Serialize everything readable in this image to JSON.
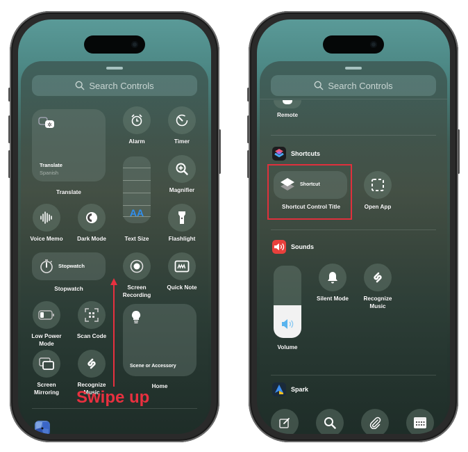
{
  "left_phone": {
    "search_placeholder": "Search Controls",
    "translate_tile": {
      "title": "Translate",
      "subtitle": "Spanish",
      "label": "Translate"
    },
    "controls": {
      "alarm": "Alarm",
      "timer": "Timer",
      "magnifier": "Magnifier",
      "text_size": "Text Size",
      "voice_memo": "Voice Memo",
      "dark_mode": "Dark Mode",
      "flashlight": "Flashlight",
      "stopwatch_tile": "Stopwatch",
      "stopwatch": "Stopwatch",
      "screen_recording": "Screen Recording",
      "quick_note": "Quick Note",
      "low_power_mode": "Low Power Mode",
      "scan_code": "Scan Code",
      "screen_mirroring": "Screen Mirroring",
      "recognize_music": "Recognize Music",
      "home_tile": "Scene or Accessory",
      "home": "Home"
    },
    "text_size_glyph": "AA",
    "annotation": "Swipe up"
  },
  "right_phone": {
    "search_placeholder": "Search Controls",
    "remote_label": "Remote",
    "sections": {
      "shortcuts": {
        "title": "Shortcuts",
        "shortcut_tile": "Shortcut",
        "shortcut_label": "Shortcut Control Title",
        "open_app": "Open App"
      },
      "sounds": {
        "title": "Sounds",
        "volume": "Volume",
        "volume_level": 0.45,
        "silent_mode": "Silent Mode",
        "recognize_music": "Recognize Music"
      },
      "spark": {
        "title": "Spark",
        "actions": [
          "compose-icon",
          "search-icon",
          "attachment-icon",
          "calendar-icon"
        ]
      }
    }
  },
  "colors": {
    "annotation_red": "#e8303f",
    "accent_blue": "#2f8ff0",
    "sounds_red": "#e8403c"
  }
}
